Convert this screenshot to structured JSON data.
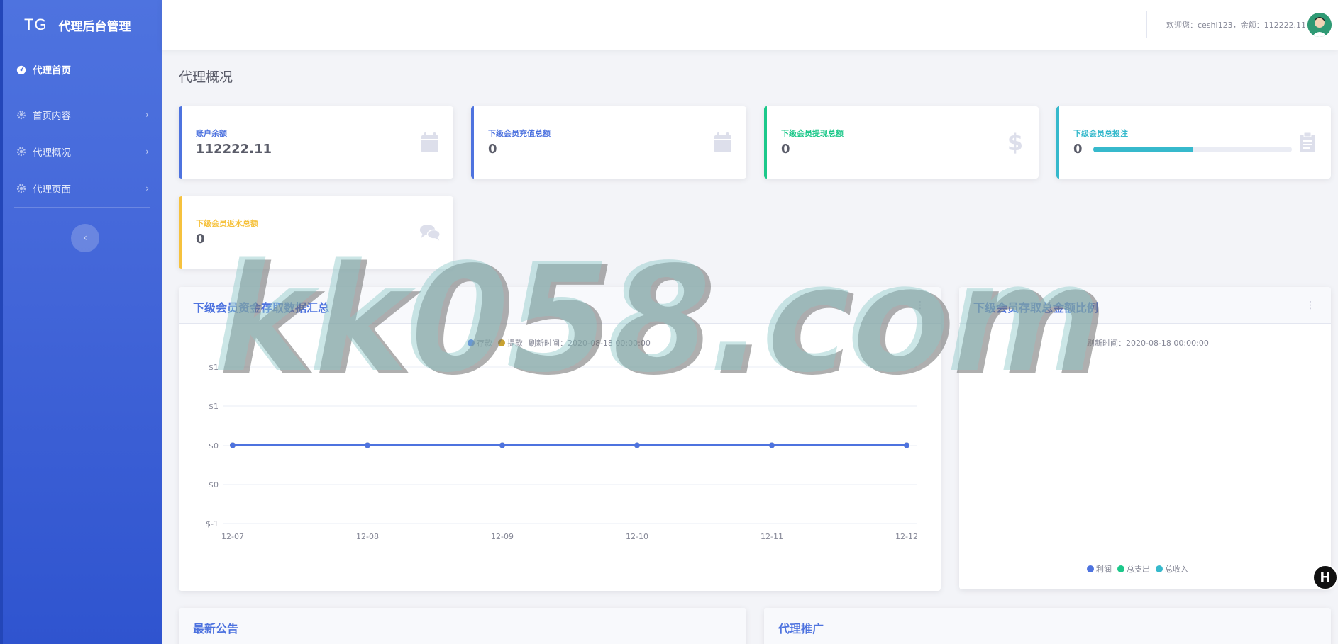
{
  "sidebar": {
    "logo": "TG",
    "brand": "代理后台管理",
    "items": [
      {
        "label": "代理首页",
        "icon": "dashboard-icon"
      },
      {
        "label": "首页内容",
        "icon": "gear-icon"
      },
      {
        "label": "代理概况",
        "icon": "gear-icon"
      },
      {
        "label": "代理页面",
        "icon": "gear-icon"
      }
    ],
    "collapse_arrow": "‹"
  },
  "topbar": {
    "welcome": "欢迎您：ceshi123，余额：112222.11"
  },
  "page": {
    "title": "代理概况"
  },
  "stats": [
    {
      "label": "账户余额",
      "value": "112222.11",
      "icon": "calendar-icon",
      "color": "#4e73df"
    },
    {
      "label": "下级会员充值总额",
      "value": "0",
      "icon": "calendar-icon",
      "color": "#4e73df"
    },
    {
      "label": "下级会员提现总额",
      "value": "0",
      "icon": "dollar-icon",
      "color": "#1cc88a"
    },
    {
      "label": "下级会员总投注",
      "value": "0",
      "icon": "clipboard-icon",
      "color": "#36b9cc",
      "progress": 0.5
    },
    {
      "label": "下级会员返水总额",
      "value": "0",
      "icon": "comments-icon",
      "color": "#f6c23e"
    }
  ],
  "line_panel": {
    "title": "下级会员资金存取数据汇总",
    "legend": [
      {
        "label": "存款",
        "color": "#4e73df"
      },
      {
        "label": "提款",
        "color": "#c8a232"
      }
    ],
    "refresh": "刷新时间：2020-08-18 00:00:00"
  },
  "pie_panel": {
    "title": "下级会员存取总金额比例",
    "refresh": "刷新时间：2020-08-18 00:00:00",
    "legend": [
      {
        "label": "利润",
        "color": "#4e73df"
      },
      {
        "label": "总支出",
        "color": "#1cc88a"
      },
      {
        "label": "总收入",
        "color": "#36b9cc"
      }
    ]
  },
  "bottom_panels": {
    "left_title": "最新公告",
    "right_title": "代理推广"
  },
  "watermark": "kk058.com",
  "corner_badge": "H",
  "chart_data": {
    "type": "line",
    "categories": [
      "12-07",
      "12-08",
      "12-09",
      "12-10",
      "12-11",
      "12-12"
    ],
    "series": [
      {
        "name": "存款",
        "values": [
          0,
          0,
          0,
          0,
          0,
          0
        ]
      },
      {
        "name": "提款",
        "values": [
          0,
          0,
          0,
          0,
          0,
          0
        ]
      }
    ],
    "y_ticks": [
      "$1",
      "$1",
      "$0",
      "$0",
      "$-1"
    ],
    "ylim": [
      -1,
      1
    ],
    "grid": true,
    "legend": "top"
  }
}
